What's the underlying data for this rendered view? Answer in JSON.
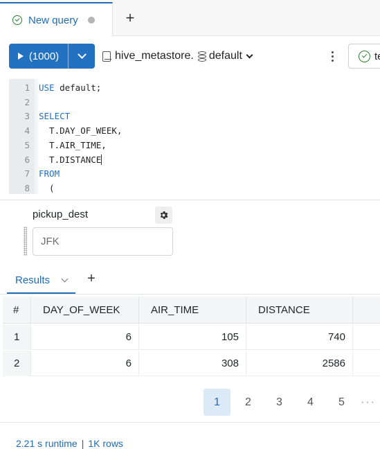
{
  "tab": {
    "label": "New query"
  },
  "toolbar": {
    "run_label": "(1000)",
    "catalog": "hive_metastore",
    "catalog_sep": ".",
    "schema": "default",
    "save_label": "te"
  },
  "editor": {
    "lines": [
      {
        "num": "1",
        "kw": "USE",
        "rest": " default;"
      },
      {
        "num": "2",
        "kw": "",
        "rest": ""
      },
      {
        "num": "3",
        "kw": "SELECT",
        "rest": ""
      },
      {
        "num": "4",
        "kw": "",
        "rest": "  T.DAY_OF_WEEK,"
      },
      {
        "num": "5",
        "kw": "",
        "rest": "  T.AIR_TIME,"
      },
      {
        "num": "6",
        "kw": "",
        "rest": "  T.DISTANCE"
      },
      {
        "num": "7",
        "kw": "FROM",
        "rest": ""
      },
      {
        "num": "8",
        "kw": "",
        "rest": "  ("
      }
    ]
  },
  "parameter": {
    "label": "pickup_dest",
    "value": "JFK"
  },
  "results": {
    "tab_label": "Results",
    "columns": [
      "#",
      "DAY_OF_WEEK",
      "AIR_TIME",
      "DISTANCE"
    ],
    "rows": [
      [
        "1",
        "6",
        "105",
        "740"
      ],
      [
        "2",
        "6",
        "308",
        "2586"
      ]
    ]
  },
  "pagination": {
    "pages": [
      "1",
      "2",
      "3",
      "4",
      "5"
    ],
    "current": "1",
    "more": "···"
  },
  "footer": {
    "runtime": "2.21 s runtime",
    "rows": "1K rows"
  }
}
